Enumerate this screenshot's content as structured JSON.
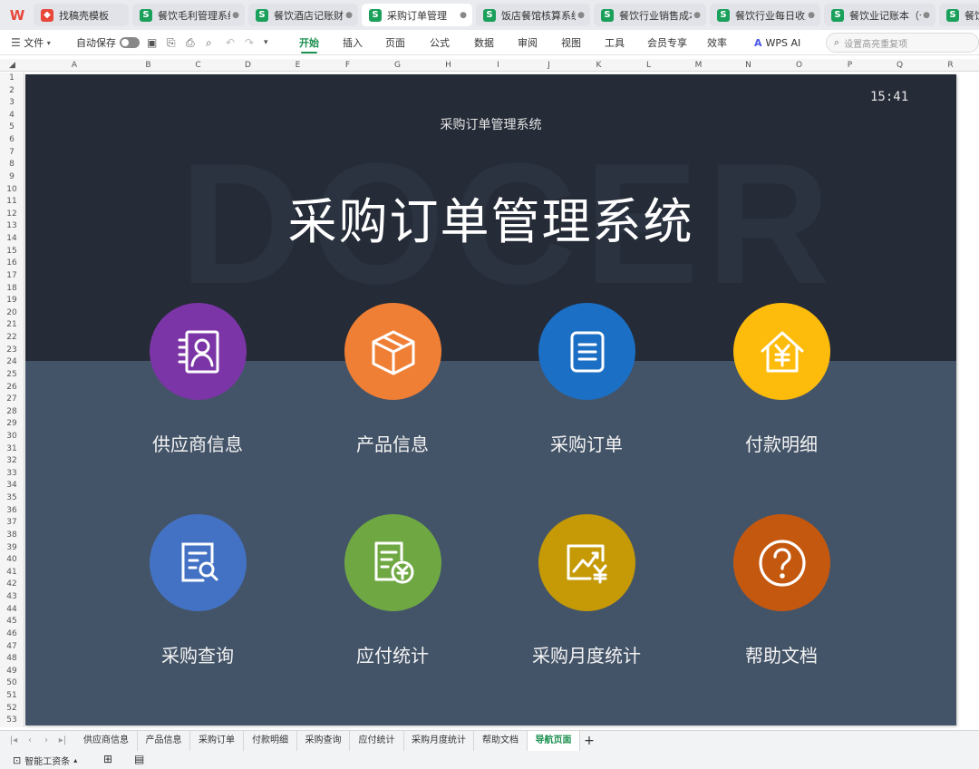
{
  "tabs": [
    {
      "label": "找稿壳模板",
      "icon": "docer",
      "closable": false
    },
    {
      "label": "餐饮毛利管理系统",
      "icon": "S",
      "closable": true
    },
    {
      "label": "餐饮酒店记账财务",
      "icon": "S",
      "closable": true
    },
    {
      "label": "采购订单管理",
      "icon": "S",
      "closable": true,
      "active": true
    },
    {
      "label": "饭店餐馆核算系统",
      "icon": "S",
      "closable": true
    },
    {
      "label": "餐饮行业销售成本",
      "icon": "S",
      "closable": true
    },
    {
      "label": "餐饮行业每日收支",
      "icon": "S",
      "closable": true
    },
    {
      "label": "餐饮业记账本（十二",
      "icon": "S",
      "closable": true
    },
    {
      "label": "餐饮",
      "icon": "S",
      "closable": false
    }
  ],
  "ribbon": {
    "file": "文件",
    "autosave": "自动保存",
    "menus": [
      "开始",
      "插入",
      "页面",
      "公式",
      "数据",
      "审阅",
      "视图",
      "工具",
      "会员专享",
      "效率"
    ],
    "active_menu": "开始",
    "wps_ai": "WPS AI",
    "search_placeholder": "设置高亮重复项"
  },
  "columns": [
    "A",
    "B",
    "C",
    "D",
    "E",
    "F",
    "G",
    "H",
    "I",
    "J",
    "K",
    "L",
    "M",
    "N",
    "O",
    "P",
    "Q",
    "R"
  ],
  "row_count": 53,
  "dashboard": {
    "clock": "15:41",
    "subtitle": "采购订单管理系统",
    "title": "采购订单管理系统",
    "watermark": "DOCER",
    "tiles": [
      {
        "label": "供应商信息",
        "icon": "contact-card-icon",
        "color": "#7b35a7"
      },
      {
        "label": "产品信息",
        "icon": "box-icon",
        "color": "#f07f36"
      },
      {
        "label": "采购订单",
        "icon": "document-icon",
        "color": "#1b6fc4"
      },
      {
        "label": "付款明细",
        "icon": "house-yen-icon",
        "color": "#fdbb0c"
      },
      {
        "label": "采购查询",
        "icon": "search-report-icon",
        "color": "#4372c4"
      },
      {
        "label": "应付统计",
        "icon": "invoice-yen-icon",
        "color": "#6fa843"
      },
      {
        "label": "采购月度统计",
        "icon": "chart-yen-icon",
        "color": "#c59a06"
      },
      {
        "label": "帮助文档",
        "icon": "help-icon",
        "color": "#c5580f"
      }
    ]
  },
  "sheets": [
    "供应商信息",
    "产品信息",
    "采购订单",
    "付款明细",
    "采购查询",
    "应付统计",
    "采购月度统计",
    "帮助文档",
    "导航页面"
  ],
  "active_sheet": "导航页面",
  "status": {
    "smart_tool": "智能工资条"
  }
}
